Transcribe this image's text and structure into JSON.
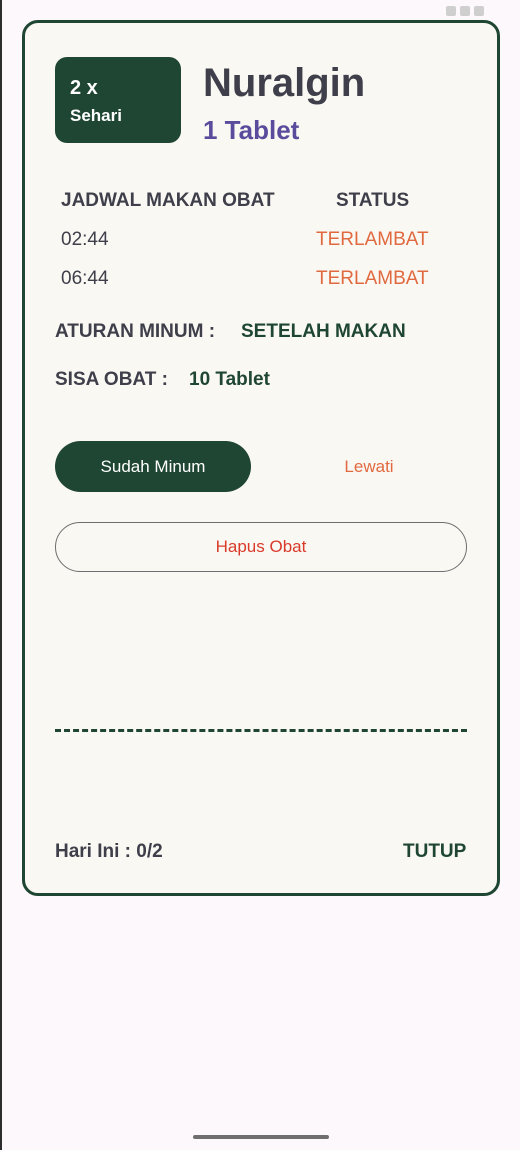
{
  "medicine": {
    "frequency_count": "2 x",
    "frequency_label": "Sehari",
    "name": "Nuralgin",
    "dose": "1 Tablet"
  },
  "schedule": {
    "header_schedule": "JADWAL MAKAN OBAT",
    "header_status": "STATUS",
    "rows": [
      {
        "time": "02:44",
        "status": "TERLAMBAT"
      },
      {
        "time": "06:44",
        "status": "TERLAMBAT"
      }
    ]
  },
  "rule": {
    "label": "ATURAN MINUM :",
    "value": "SETELAH MAKAN"
  },
  "stock": {
    "label": "SISA OBAT :",
    "value": "10 Tablet"
  },
  "actions": {
    "taken_label": "Sudah Minum",
    "skip_label": "Lewati",
    "delete_label": "Hapus Obat"
  },
  "footer": {
    "today_text": "Hari Ini : 0/2",
    "close_label": "TUTUP"
  },
  "colors": {
    "primary": "#1f4633",
    "accent_purple": "#5b4b9c",
    "late": "#e0693f",
    "danger": "#d93a2b"
  }
}
